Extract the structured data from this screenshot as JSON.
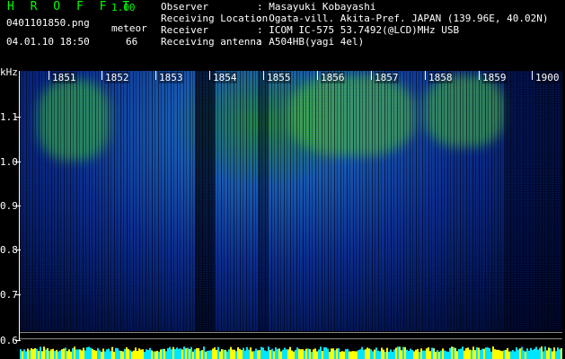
{
  "header": {
    "app_title": "H R O F F T",
    "version": "1.00",
    "file_name": "0401101850.png",
    "datetime": "04.01.10 18:50",
    "mode_label": "meteor",
    "count": "66"
  },
  "info": [
    {
      "key": "Observer",
      "value": ": Masayuki Kobayashi"
    },
    {
      "key": "Receiving Location",
      "value": ": Ogata-vill. Akita-Pref. JAPAN (139.96E, 40.02N)"
    },
    {
      "key": "Receiver",
      "value": ": ICOM IC-575 53.7492(@LCD)MHz USB"
    },
    {
      "key": "Receiving antenna",
      "value": ": A504HB(yagi 4el)"
    }
  ],
  "time_axis": [
    "1851",
    "1852",
    "1853",
    "1854",
    "1855",
    "1856",
    "1857",
    "1858",
    "1859",
    "1900"
  ],
  "freq_axis": {
    "unit": "kHz",
    "labels": [
      "1.1",
      "1.0",
      "0.9",
      "0.8",
      "0.7",
      "0.6"
    ]
  },
  "colors": {
    "title_green": "#00ff00",
    "signal_cyan": "#00e5ff",
    "signal_yellow": "#ffff00"
  }
}
